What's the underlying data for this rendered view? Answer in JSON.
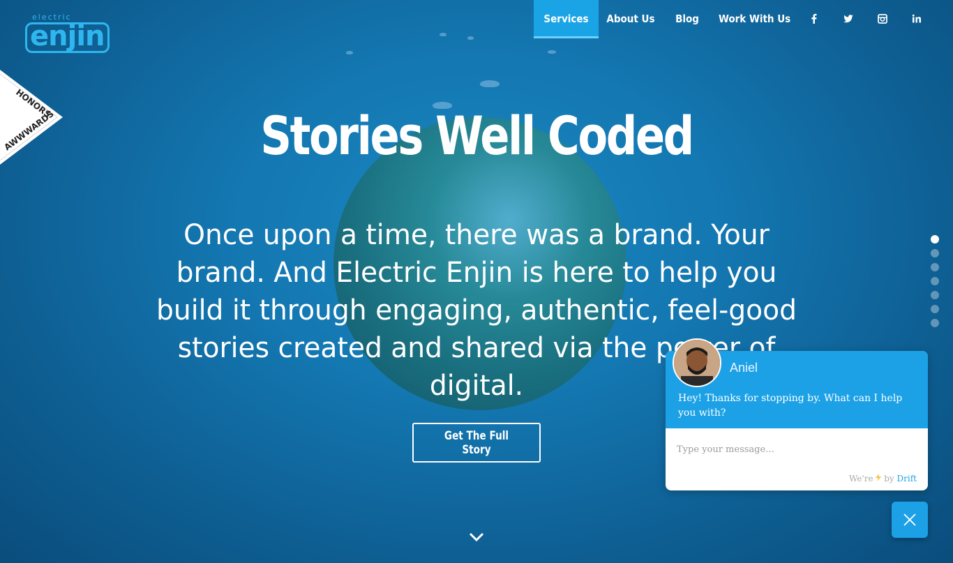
{
  "brand": {
    "small": "electric",
    "main": "enjin",
    "color": "#30b6ee"
  },
  "nav": {
    "items": [
      {
        "label": "Services",
        "active": true
      },
      {
        "label": "About Us",
        "active": false
      },
      {
        "label": "Blog",
        "active": false
      },
      {
        "label": "Work With Us",
        "active": false
      }
    ],
    "social": [
      "facebook-icon",
      "twitter-icon",
      "instagram-icon",
      "linkedin-icon"
    ]
  },
  "badge": {
    "top": "HONORS",
    "bottom": "AWWWARDS"
  },
  "hero": {
    "title": "Stories Well Coded",
    "tagline": "Once upon a time, there was a brand. Your brand. And Electric Enjin is here to help you build it through engaging, authentic, feel-good stories created and shared via the power of digital.",
    "cta": "Get The Full Story"
  },
  "section_dots": {
    "count": 7,
    "active_index": 0
  },
  "chat": {
    "agent": "Aniel",
    "message": "Hey! Thanks for stopping by. What can I help you with?",
    "placeholder": "Type your message...",
    "powered_prefix": "We're",
    "powered_by": "by",
    "powered_brand": "Drift",
    "accent": "#1da1e6"
  }
}
